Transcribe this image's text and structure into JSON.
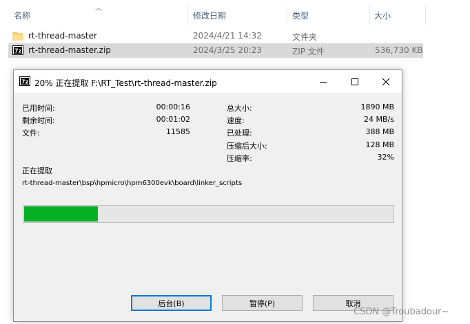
{
  "explorer": {
    "columns": {
      "name": "名称",
      "date": "修改日期",
      "type": "类型",
      "size": "大小"
    },
    "rows": [
      {
        "name": "rt-thread-master",
        "date": "2024/4/21 14:32",
        "type": "文件夹",
        "size": "",
        "icon": "folder-icon"
      },
      {
        "name": "rt-thread-master.zip",
        "date": "2024/3/25 20:23",
        "type": "ZIP 文件",
        "size": "536,730 KB",
        "icon": "7zip-archive-icon"
      }
    ]
  },
  "dialog": {
    "title": "20% 正在提取 F:\\RT_Test\\rt-thread-master.zip",
    "stats_left": [
      {
        "label": "已用时间:",
        "value": "00:00:16"
      },
      {
        "label": "剩余时间:",
        "value": "00:01:02"
      },
      {
        "label": "文件:",
        "value": "11585"
      }
    ],
    "stats_right": [
      {
        "label": "总大小:",
        "value": "1890 MB"
      },
      {
        "label": "速度:",
        "value": "24 MB/s"
      },
      {
        "label": "已处理:",
        "value": "388 MB"
      },
      {
        "label": "压缩后大小:",
        "value": "128 MB"
      },
      {
        "label": "压缩率:",
        "value": "32%"
      }
    ],
    "status_label": "正在提取",
    "current_path": "rt-thread-master\\bsp\\hpmicro\\hpm6300evk\\board\\linker_scripts",
    "progress_fraction": 0.2,
    "progress_color": "#06b025",
    "buttons": {
      "background": "后台(B)",
      "pause": "暂停(P)",
      "cancel": "取消"
    }
  },
  "watermark": "CSDN @Troubadour~"
}
